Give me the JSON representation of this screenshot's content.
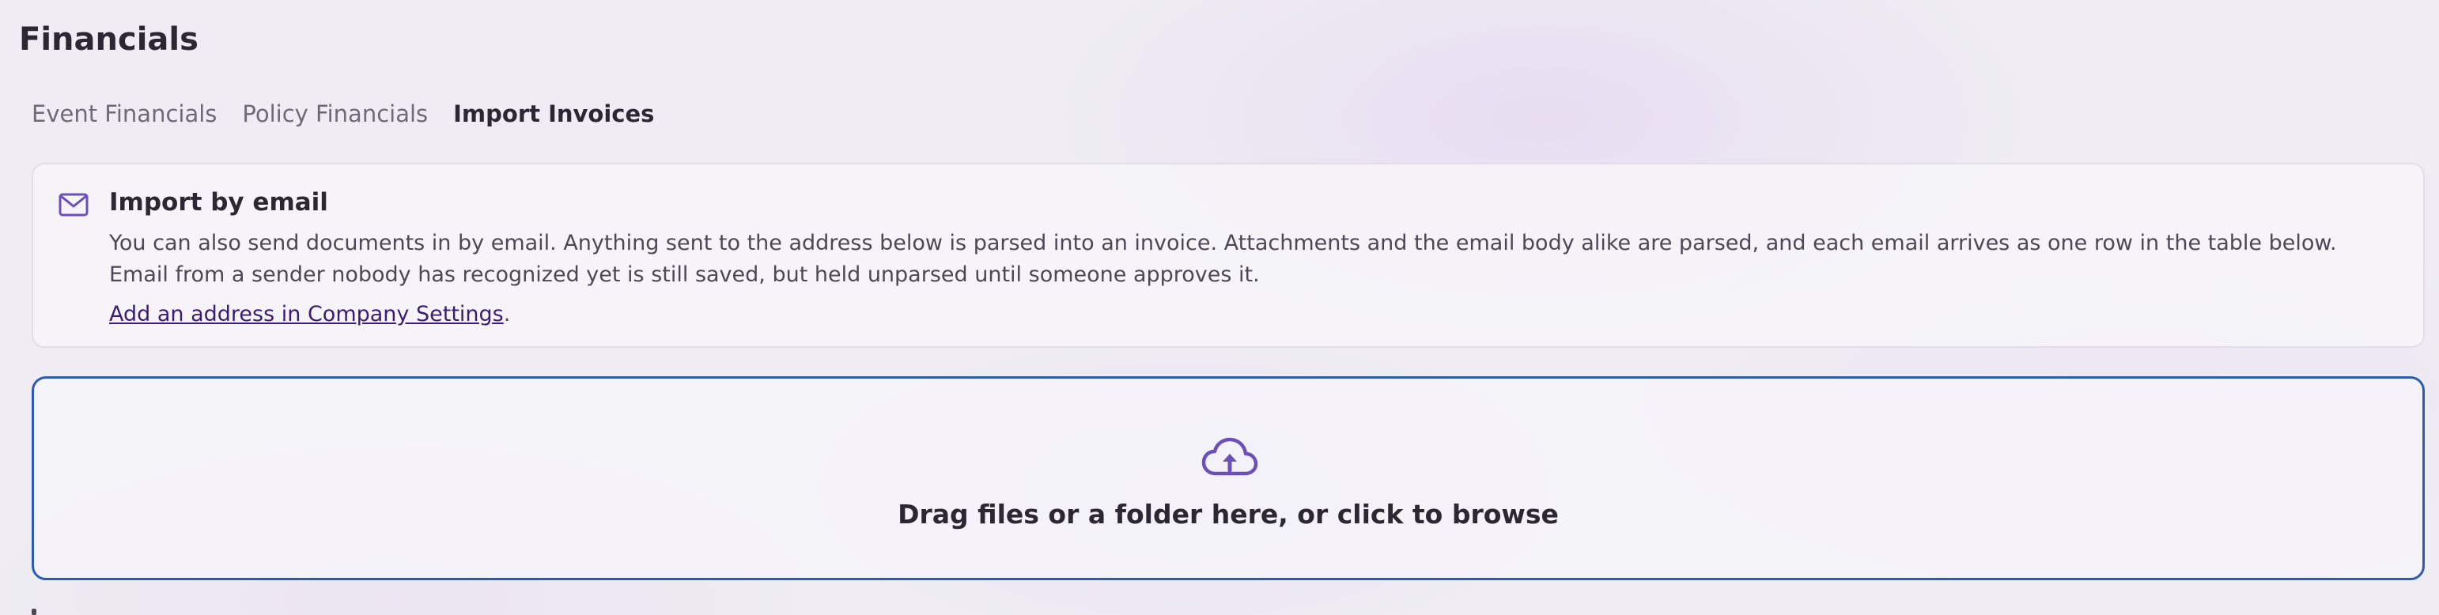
{
  "page": {
    "title": "Financials"
  },
  "tabs": [
    {
      "label": "Event Financials",
      "active": false
    },
    {
      "label": "Policy Financials",
      "active": false
    },
    {
      "label": "Import Invoices",
      "active": true
    }
  ],
  "email_import": {
    "icon": "mail-icon",
    "title": "Import by email",
    "description": "You can also send documents in by email. Anything sent to the address below is parsed into an invoice. Attachments and the email body alike are parsed, and each email arrives as one row in the table below. Email from a sender nobody has recognized yet is still saved, but held unparsed until someone approves it.",
    "link_label": "Add an address in Company Settings",
    "link_suffix": "."
  },
  "dropzone": {
    "icon": "cloud-upload-icon",
    "label": "Drag files or a folder here, or click to browse"
  },
  "colors": {
    "accent": "#6b4fbb",
    "dropzone_border": "#2b5cb3",
    "link": "#3a1d73"
  }
}
